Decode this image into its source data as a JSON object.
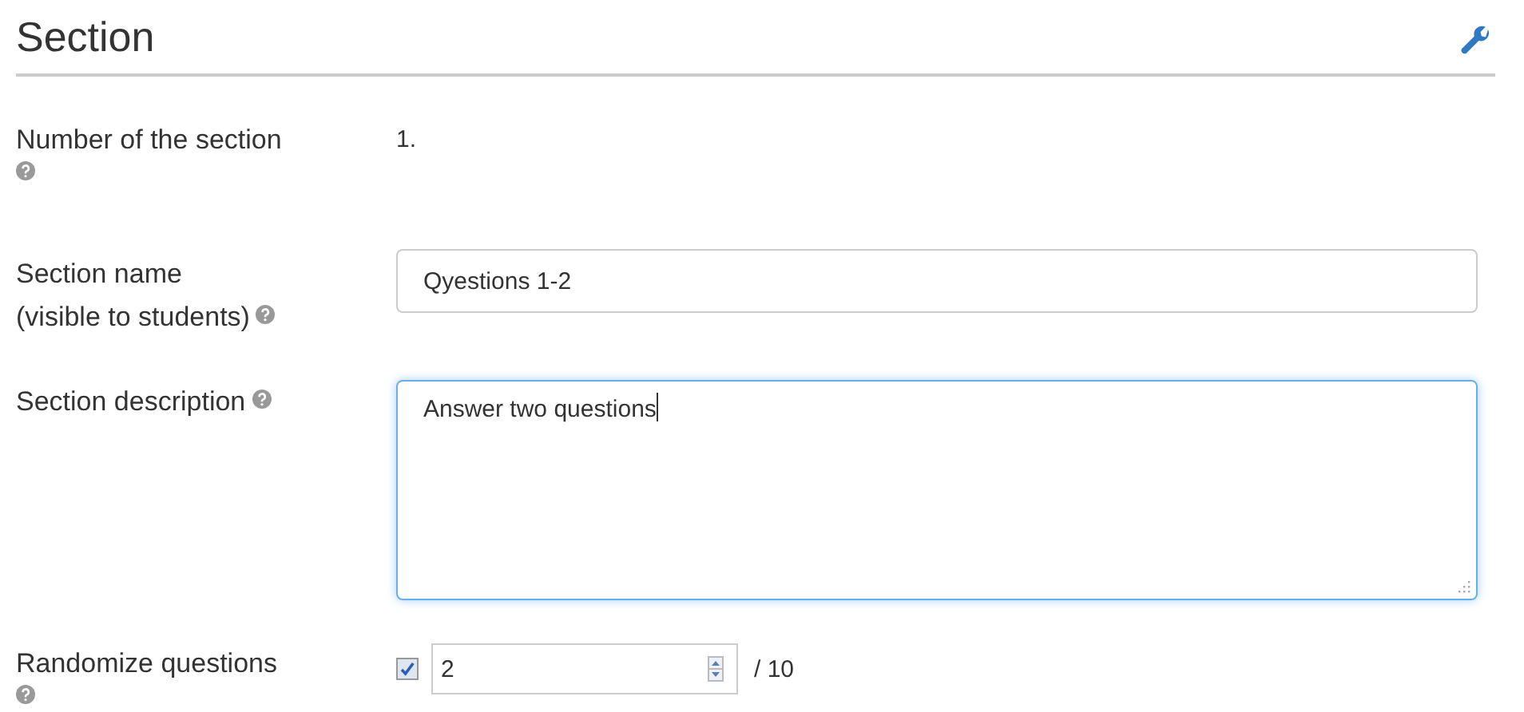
{
  "title": "Section",
  "fields": [
    {
      "kind": "static",
      "label": "Number of the section",
      "help": true,
      "value": "1."
    },
    {
      "kind": "text",
      "label": "Section name",
      "sublabel": "(visible to students)",
      "help": true,
      "value": "Qyestions 1-2",
      "focused": false
    },
    {
      "kind": "textarea",
      "label": "Section description",
      "help": true,
      "value": "Answer two questions",
      "focused": true
    },
    {
      "kind": "number",
      "label": "Randomize questions",
      "help": true,
      "checked": true,
      "value": "2",
      "suffix": "/ 10"
    }
  ]
}
